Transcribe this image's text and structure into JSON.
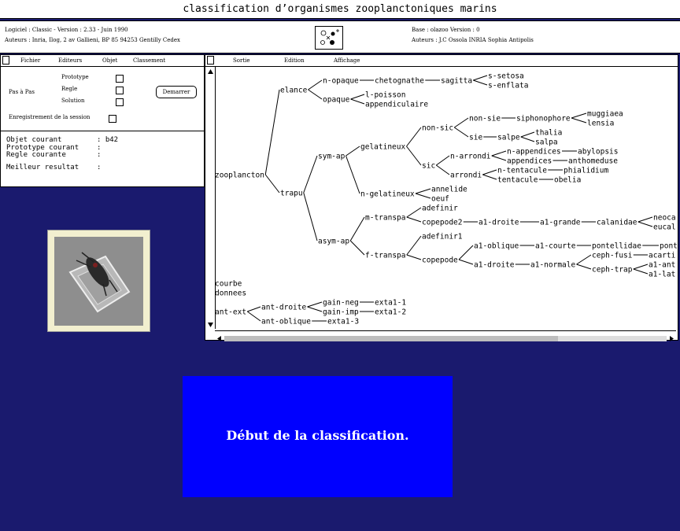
{
  "window": {
    "title": "classification d’organismes zooplanctoniques marins"
  },
  "info": {
    "software": "Logiciel : Classic  -  Version : 2.33   -  Juin 1990",
    "authors_left": "Auteurs : Inria, Ilog, 2 av Gallieni, BP 85 94253 Gentilly Cedex",
    "base": "Base : olazoo  Version :   0",
    "authors_right": "Auteurs : J.C Ossola INRIA Sophia Antipolis"
  },
  "control_menu": [
    "Fichier",
    "Editeurs",
    "Objet",
    "Classement"
  ],
  "controls": {
    "pas_a_pas": "Pas à Pas",
    "prototype": "Prototype",
    "regle": "Regle",
    "solution": "Solution",
    "demarrer": "Demarrer",
    "enregistrement": "Enregistrement de la session"
  },
  "status": {
    "objet_label": "Objet courant",
    "objet_value": ": b42",
    "prototype_label": "Prototype courant",
    "prototype_value": ":",
    "regle_label": "Regle courante",
    "regle_value": ":",
    "meilleur_label": "Meilleur resultat",
    "meilleur_value": ":"
  },
  "tree_menu": [
    "Sortie",
    "Edition",
    "Affichage"
  ],
  "tree_labels": {
    "zooplancton": "zooplancton",
    "elance": "elance",
    "trapu": "trapu",
    "n_opaque": "n-opaque",
    "opaque": "opaque",
    "chetognathe": "chetognathe",
    "sagitta": "sagitta",
    "s_setosa": "s-setosa",
    "s_enflata": "s-enflata",
    "l_poisson": "l-poisson",
    "appendiculaire": "appendiculaire",
    "sym_ap": "sym-ap",
    "asym_ap": "asym-ap",
    "gelatineux": "gelatineux",
    "n_gelatineux": "n-gelatineux",
    "non_sic": "non-sic",
    "sic": "sic",
    "non_sie": "non-sie",
    "siphonophore": "siphonophore",
    "muggiaea": "muggiaea",
    "lensia": "lensia",
    "sie": "sie",
    "salpe": "salpe",
    "thalia": "thalia",
    "salpa": "salpa",
    "n_arrondi": "n-arrondi",
    "arrondi": "arrondi",
    "n_appendices": "n-appendices",
    "abylopsis": "abylopsis",
    "appendices": "appendices",
    "anthomeduse": "anthomeduse",
    "n_tentacule": "n-tentacule",
    "phialidium": "phialidium",
    "tentacule": "tentacule",
    "obelia": "obelia",
    "annelide": "annelide",
    "oeuf": "oeuf",
    "m_transpa": "m-transpa",
    "f_transpa": "f-transpa",
    "adefinir": "adefinir",
    "copepode2": "copepode2",
    "a1_droite": "a1-droite",
    "a1_grande": "a1-grande",
    "calanidae": "calanidae",
    "neoca": "neoca",
    "eucal": "eucal",
    "adefinir1": "adefinir1",
    "copepode": "copepode",
    "a1_oblique": "a1-oblique",
    "a1_courte": "a1-courte",
    "pontellidae": "pontellidae",
    "pont": "pont",
    "a1_droite2": "a1-droite",
    "a1_normale": "a1-normale",
    "ceph_fusi": "ceph-fusi",
    "acarti": "acarti",
    "ceph_trap": "ceph-trap",
    "a1_ant": "a1-ant",
    "a1_lat": "a1-lat",
    "courbe": "courbe",
    "donnees": "donnees",
    "ant_ext": "ant-ext",
    "ant_droite": "ant-droite",
    "ant_oblique": "ant-oblique",
    "gain_neg": "gain-neg",
    "gain_imp": "gain-imp",
    "exta1_1": "exta1-1",
    "exta1_2": "exta1-2",
    "exta1_3": "exta1-3"
  },
  "message": "Début de la classification."
}
